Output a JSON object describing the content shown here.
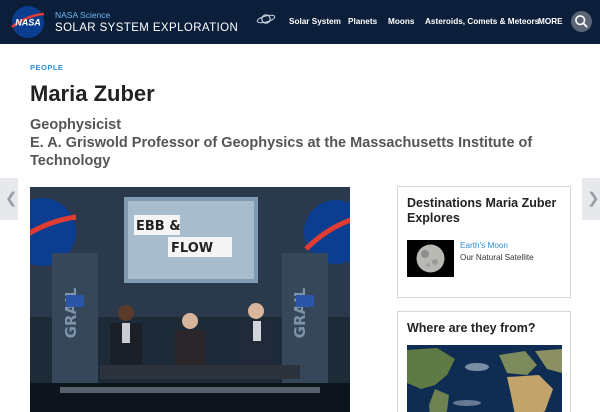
{
  "header": {
    "logo_text": "NASA",
    "site_subtitle": "NASA Science",
    "site_title": "SOLAR SYSTEM EXPLORATION",
    "nav": [
      "Solar System",
      "Planets",
      "Moons",
      "Asteroids, Comets & Meteors",
      "MORE"
    ]
  },
  "page": {
    "eyebrow": "PEOPLE",
    "title": "Maria Zuber",
    "role_line1": "Geophysicist",
    "role_line2": "E. A. Griswold Professor of Geophysics at the Massachusetts Institute of Technology"
  },
  "photo": {
    "screen_text_top": "EBB &",
    "screen_text_bottom": "FLOW",
    "banner_text": "GRAIL"
  },
  "destinations": {
    "title": "Destinations Maria Zuber Explores",
    "items": [
      {
        "name": "Earth's Moon",
        "subtitle": "Our Natural Satellite"
      }
    ]
  },
  "origin": {
    "title": "Where are they from?"
  },
  "colors": {
    "header_bg": "#0b1f3a",
    "accent": "#2e8fd6",
    "nasa_red": "#e03c31",
    "nasa_blue": "#0b3d91"
  },
  "icons": {
    "search": "search-icon",
    "planet": "planet-icon",
    "prev": "chevron-left-icon",
    "next": "chevron-right-icon"
  }
}
